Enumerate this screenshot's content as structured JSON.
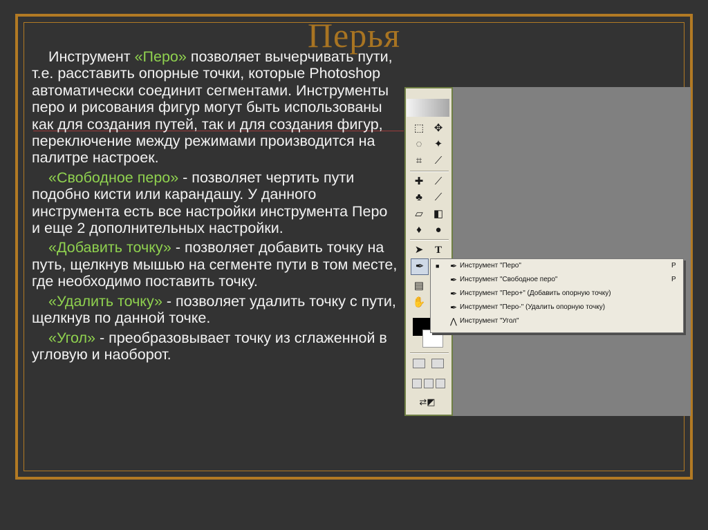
{
  "slide": {
    "title": "Перья",
    "paragraphs": [
      {
        "pre": "Инструмент ",
        "hl": "«Перо»",
        "post": " позволяет вычерчивать пути, т.е. расставить опорные точки, которые Photoshop автоматически соединит сегментами. Инструменты перо и рисования фигур могут быть использованы как для создания путей, так и для создания фигур, переключение между режимами производится на палитре настроек."
      },
      {
        "pre": "",
        "hl": "«Свободное перо»",
        "post": " - позволяет чертить пути подобно кисти или карандашу. У данного инструмента есть все настройки инструмента Перо и еще 2 дополнительных настройки."
      },
      {
        "pre": "",
        "hl": "«Добавить точку»",
        "post": " - позволяет добавить точку на путь, щелкнув мышью на сегменте пути в том месте, где необходимо поставить точку."
      },
      {
        "pre": "",
        "hl": "«Удалить точку»",
        "post": " - позволяет удалить точку с пути, щелкнув по данной точке."
      },
      {
        "pre": "",
        "hl": "«Угол»",
        "post": " - преобразовывает точку из сглаженной в угловую и наоборот."
      }
    ]
  },
  "colors": {
    "accent": "#b27a24",
    "highlight": "#8fd14f",
    "text": "#f2f2f2",
    "background": "#333333"
  },
  "toolbox": {
    "icons": [
      "marquee-icon",
      "move-icon",
      "lasso-icon",
      "magic-wand-icon",
      "crop-icon",
      "slice-icon",
      "healing-brush-icon",
      "brush-icon",
      "stamp-icon",
      "history-brush-icon",
      "eraser-icon",
      "gradient-icon",
      "blur-icon",
      "dodge-icon",
      "path-select-icon",
      "type-icon",
      "pen-icon",
      "shape-icon",
      "notes-icon",
      "eyedropper-icon",
      "hand-icon",
      "zoom-icon"
    ],
    "glyphs": {
      "type": "T"
    }
  },
  "menu": {
    "items": [
      {
        "bullet": "■",
        "label": "Инструмент \"Перо\"",
        "key": "P"
      },
      {
        "bullet": "",
        "label": "Инструмент \"Свободное перо\"",
        "key": "P"
      },
      {
        "bullet": "",
        "label": "Инструмент \"Перо+\" (Добавить опорную точку)",
        "key": ""
      },
      {
        "bullet": "",
        "label": "Инструмент \"Перо-\" (Удалить опорную точку)",
        "key": ""
      },
      {
        "bullet": "",
        "label": "Инструмент \"Угол\"",
        "key": ""
      }
    ]
  }
}
